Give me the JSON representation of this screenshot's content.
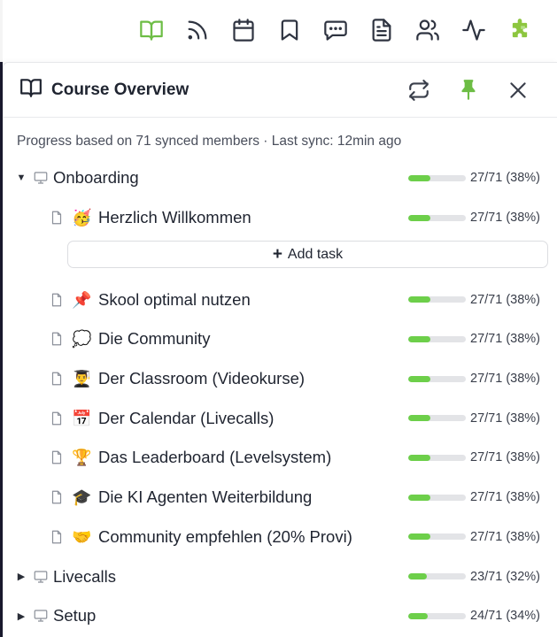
{
  "toolbar": {
    "icons": [
      "book-open-icon",
      "rss-icon",
      "calendar-icon",
      "bookmark-icon",
      "chat-icon",
      "document-icon",
      "users-icon",
      "activity-icon",
      "puzzle-icon"
    ],
    "active": "book-open-icon",
    "accent": "#6dbd45"
  },
  "panel": {
    "title": "Course Overview",
    "meta": "Progress based on 71 synced members · Last sync: 12min ago"
  },
  "add_task_label": "Add task",
  "modules": [
    {
      "label": "Onboarding",
      "expanded": true,
      "count": "27/71 (38%)",
      "progress": 0.38,
      "lessons": [
        {
          "emoji": "🥳",
          "label": "Herzlich Willkommen",
          "count": "27/71 (38%)",
          "progress": 0.38
        },
        {
          "emoji": "📌",
          "label": "Skool optimal nutzen",
          "count": "27/71 (38%)",
          "progress": 0.38
        },
        {
          "emoji": "💭",
          "label": "Die Community",
          "count": "27/71 (38%)",
          "progress": 0.38
        },
        {
          "emoji": "👨‍🎓",
          "label": "Der Classroom (Videokurse)",
          "count": "27/71 (38%)",
          "progress": 0.38
        },
        {
          "emoji": "📅",
          "label": "Der Calendar (Livecalls)",
          "count": "27/71 (38%)",
          "progress": 0.38
        },
        {
          "emoji": "🏆",
          "label": "Das Leaderboard (Levelsystem)",
          "count": "27/71 (38%)",
          "progress": 0.38
        },
        {
          "emoji": "🎓",
          "label": "Die KI Agenten Weiterbildung",
          "count": "27/71 (38%)",
          "progress": 0.38
        },
        {
          "emoji": "🤝",
          "label": "Community empfehlen (20% Provi)",
          "count": "27/71 (38%)",
          "progress": 0.38
        }
      ]
    },
    {
      "label": "Livecalls",
      "expanded": false,
      "count": "23/71 (32%)",
      "progress": 0.32,
      "lessons": []
    },
    {
      "label": "Setup",
      "expanded": false,
      "count": "24/71 (34%)",
      "progress": 0.34,
      "lessons": []
    }
  ]
}
